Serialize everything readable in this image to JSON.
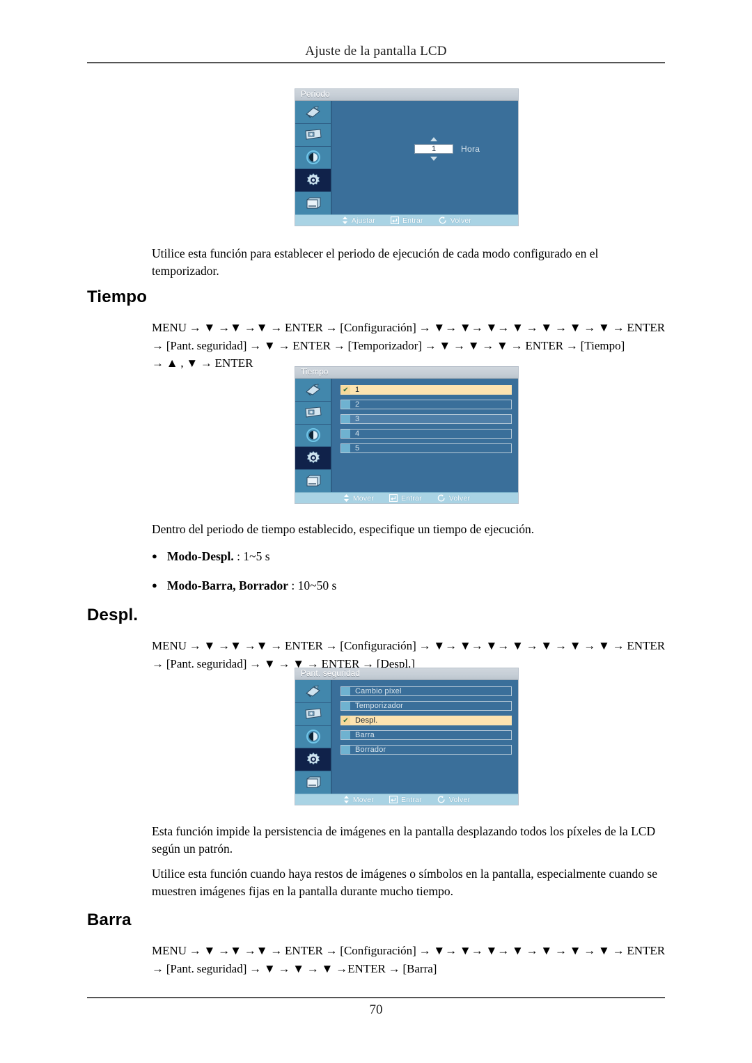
{
  "page": {
    "running_header": "Ajuste de la pantalla LCD",
    "page_number": "70"
  },
  "sections": [
    {
      "id": "periodo",
      "paragraph": "Utilice esta función para establecer el periodo de ejecución de cada modo configurado en el temporizador."
    },
    {
      "id": "tiempo",
      "heading": "Tiempo",
      "menu_path_line1": "MENU → ▼ →▼ →▼ → ENTER → [Configuración] → ▼→ ▼→ ▼→ ▼ → ▼ → ▼ → ▼ → ENTER",
      "menu_path_line2": "→ [Pant. seguridad] → ▼ → ENTER → [Temporizador] → ▼ → ▼ → ▼ → ENTER → [Tiempo]",
      "menu_path_line3": "→ ▲ , ▼ → ENTER",
      "paragraph": "Dentro del periodo de tiempo establecido, especifique un tiempo de ejecución.",
      "bullets": [
        {
          "label": "Modo-Despl.",
          "value": ": 1~5 s"
        },
        {
          "label": "Modo-Barra, Borrador",
          "value": ": 10~50 s"
        }
      ]
    },
    {
      "id": "despl",
      "heading": "Despl.",
      "menu_path_line1": "MENU → ▼ →▼ →▼ → ENTER → [Configuración] → ▼→ ▼→ ▼→ ▼ → ▼ → ▼ → ▼ → ENTER",
      "menu_path_line2": "→ [Pant. seguridad] → ▼ → ▼ → ENTER → [Despl.]",
      "paragraph1": "Esta función impide la persistencia de imágenes en la pantalla desplazando todos los píxeles de la LCD según un patrón.",
      "paragraph2": "Utilice esta función cuando haya restos de imágenes o símbolos en la pantalla, especialmente cuando se muestren imágenes fijas en la pantalla durante mucho tiempo."
    },
    {
      "id": "barra",
      "heading": "Barra",
      "menu_path_line1": "MENU → ▼ →▼ →▼ → ENTER → [Configuración] → ▼→ ▼→ ▼→ ▼ → ▼ → ▼ → ▼ → ENTER",
      "menu_path_line2": "→ [Pant. seguridad] → ▼ → ▼ → ▼ →ENTER → [Barra]"
    }
  ],
  "osd_periodo": {
    "title": "Periodo",
    "sidebar_icons": [
      "input-source-icon",
      "picture-icon",
      "contrast-icon",
      "setup-gear-icon",
      "multi-control-icon"
    ],
    "selected_sidebar_index": 3,
    "value": "1",
    "unit": "Hora",
    "footer": [
      {
        "icon": "up-down-arrow-icon",
        "label": "Ajustar"
      },
      {
        "icon": "enter-key-icon",
        "label": "Entrar"
      },
      {
        "icon": "return-arrow-icon",
        "label": "Volver"
      }
    ]
  },
  "osd_tiempo": {
    "title": "Tiempo",
    "sidebar_icons": [
      "input-source-icon",
      "picture-icon",
      "contrast-icon",
      "setup-gear-icon",
      "multi-control-icon"
    ],
    "selected_sidebar_index": 3,
    "items": [
      {
        "label": "1",
        "selected": true
      },
      {
        "label": "2",
        "selected": false
      },
      {
        "label": "3",
        "selected": false
      },
      {
        "label": "4",
        "selected": false
      },
      {
        "label": "5",
        "selected": false
      }
    ],
    "footer": [
      {
        "icon": "up-down-arrow-icon",
        "label": "Mover"
      },
      {
        "icon": "enter-key-icon",
        "label": "Entrar"
      },
      {
        "icon": "return-arrow-icon",
        "label": "Volver"
      }
    ]
  },
  "osd_pant_seguridad": {
    "title": "Pant. seguridad",
    "sidebar_icons": [
      "input-source-icon",
      "picture-icon",
      "contrast-icon",
      "setup-gear-icon",
      "multi-control-icon"
    ],
    "selected_sidebar_index": 3,
    "items": [
      {
        "label": "Cambio píxel",
        "selected": false
      },
      {
        "label": "Temporizador",
        "selected": false
      },
      {
        "label": "Despl.",
        "selected": true
      },
      {
        "label": "Barra",
        "selected": false
      },
      {
        "label": "Borrador",
        "selected": false
      }
    ],
    "footer": [
      {
        "icon": "up-down-arrow-icon",
        "label": "Mover"
      },
      {
        "icon": "enter-key-icon",
        "label": "Entrar"
      },
      {
        "icon": "return-arrow-icon",
        "label": "Volver"
      }
    ]
  },
  "colors": {
    "osd_background": "#3a6f9a",
    "osd_sidebar": "#4287ac",
    "osd_sidebar_selected": "#10224a",
    "osd_title_bar": "#c6ced6",
    "osd_footer": "#a9d3e4",
    "osd_row_highlight": "#fde3b0",
    "osd_row_swatch": "#6fb2d0"
  }
}
